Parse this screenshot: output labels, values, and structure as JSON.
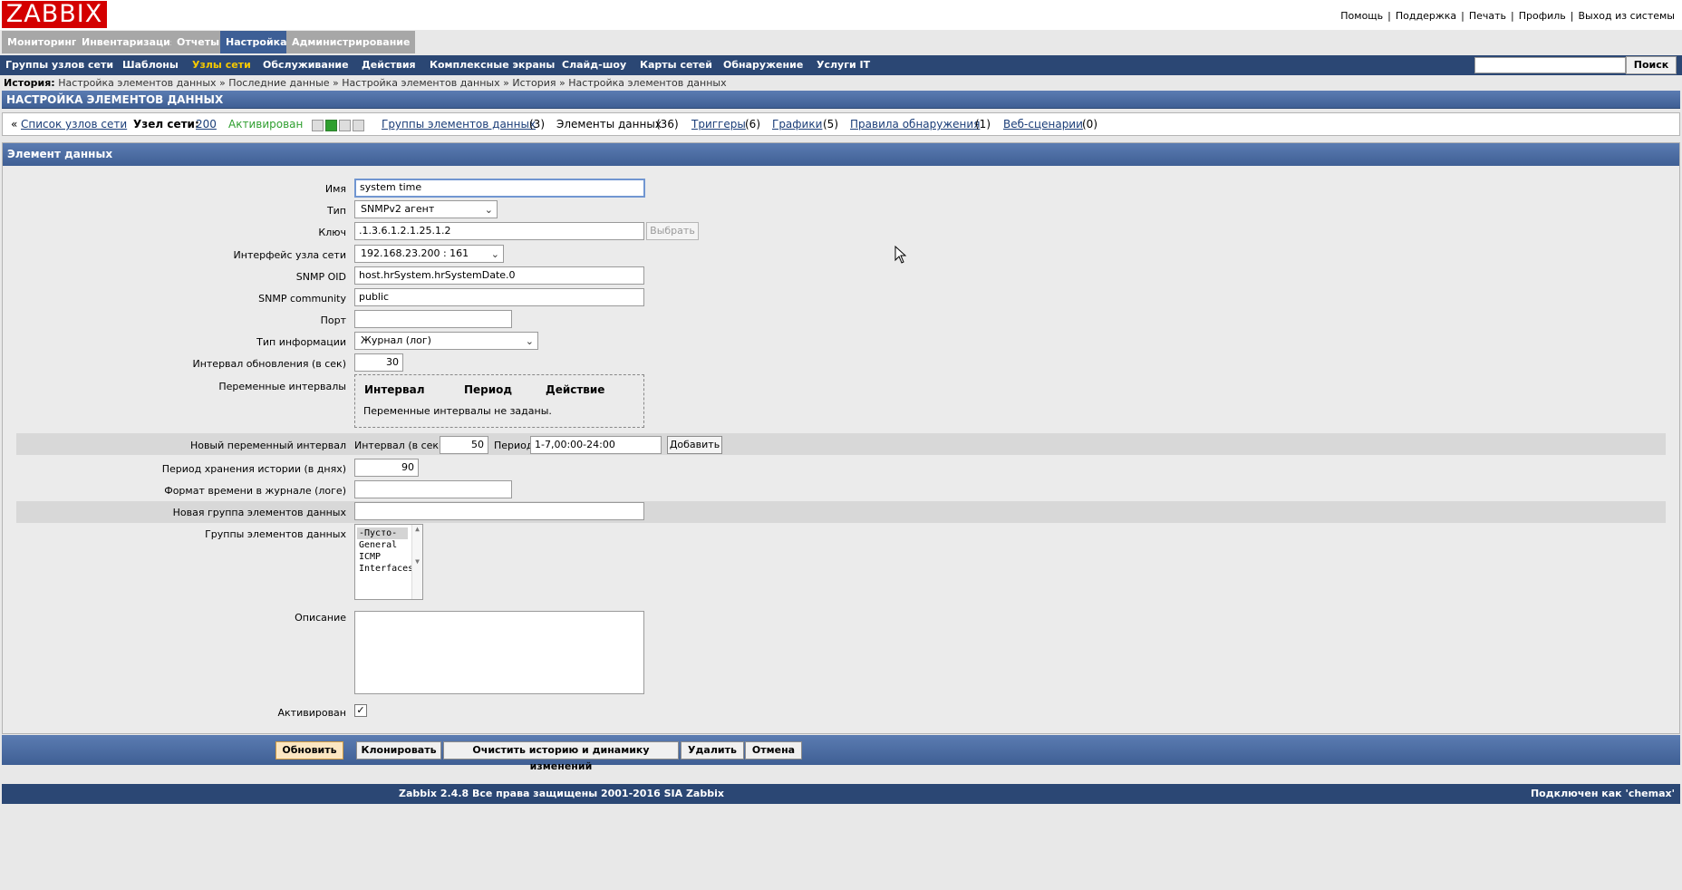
{
  "logo": "ZABBIX",
  "toplinks": [
    "Помощь",
    "Поддержка",
    "Печать",
    "Профиль",
    "Выход из системы"
  ],
  "mainmenu": [
    "Мониторинг",
    "Инвентаризация",
    "Отчеты",
    "Настройка",
    "Администрирование"
  ],
  "submenu": [
    "Группы узлов сети",
    "Шаблоны",
    "Узлы сети",
    "Обслуживание",
    "Действия",
    "Комплексные экраны",
    "Слайд-шоу",
    "Карты сетей",
    "Обнаружение",
    "Услуги IT"
  ],
  "search": {
    "value": "",
    "button": "Поиск"
  },
  "history": {
    "label": "История:",
    "items": [
      "Настройка элементов данных",
      "Последние данные",
      "Настройка элементов данных",
      "История",
      "Настройка элементов данных"
    ]
  },
  "page_title": "НАСТРОЙКА ЭЛЕМЕНТОВ ДАННЫХ",
  "hostbar": {
    "back_prefix": "«",
    "host_list": "Список узлов сети",
    "host_label": "Узел сети:",
    "host_name": "200",
    "status": "Активирован",
    "tabs": [
      {
        "label": "Группы элементов данных",
        "count": "(3)",
        "link": true
      },
      {
        "label": "Элементы данных",
        "count": "(36)",
        "link": false
      },
      {
        "label": "Триггеры",
        "count": "(6)",
        "link": true
      },
      {
        "label": "Графики",
        "count": "(5)",
        "link": true
      },
      {
        "label": "Правила обнаружения",
        "count": "(1)",
        "link": true
      },
      {
        "label": "Веб-сценарии",
        "count": "(0)",
        "link": true
      }
    ]
  },
  "form": {
    "header": "Элемент данных",
    "labels": {
      "name": "Имя",
      "type": "Тип",
      "key": "Ключ",
      "interface": "Интерфейс узла сети",
      "snmp_oid": "SNMP OID",
      "snmp_community": "SNMP community",
      "port": "Порт",
      "value_type": "Тип информации",
      "delay": "Интервал обновления (в сек)",
      "flex": "Переменные интервалы",
      "new_flex": "Новый переменный интервал",
      "history": "Период хранения истории (в днях)",
      "logtimefmt": "Формат времени в журнале (логе)",
      "new_app": "Новая группа элементов данных",
      "apps": "Группы элементов данных",
      "description": "Описание",
      "enabled": "Активирован"
    },
    "values": {
      "name": "system time",
      "type": "SNMPv2 агент",
      "key": ".1.3.6.1.2.1.25.1.2",
      "key_button": "Выбрать",
      "interface": "192.168.23.200 : 161",
      "snmp_oid": "host.hrSystem.hrSystemDate.0",
      "snmp_community": "public",
      "port": "",
      "value_type": "Журнал (лог)",
      "delay": "30",
      "history": "90",
      "logtimefmt": "",
      "new_app": "",
      "description": "",
      "enabled": "✓"
    },
    "flex_table": {
      "headers": [
        "Интервал",
        "Период",
        "Действие"
      ],
      "empty": "Переменные интервалы не заданы."
    },
    "new_flex": {
      "interval_label": "Интервал (в сек)",
      "interval_value": "50",
      "period_label": "Период",
      "period_value": "1-7,00:00-24:00",
      "add_button": "Добавить"
    },
    "apps_list": [
      "-Пусто-",
      "General",
      "ICMP",
      "Interfaces"
    ]
  },
  "actions": [
    "Обновить",
    "Клонировать",
    "Очистить историю и динамику изменений",
    "Удалить",
    "Отмена"
  ],
  "footer": {
    "copyright": "Zabbix 2.4.8 Все права защищены 2001-2016 SIA Zabbix",
    "user": "Подключен как 'chemax'"
  }
}
